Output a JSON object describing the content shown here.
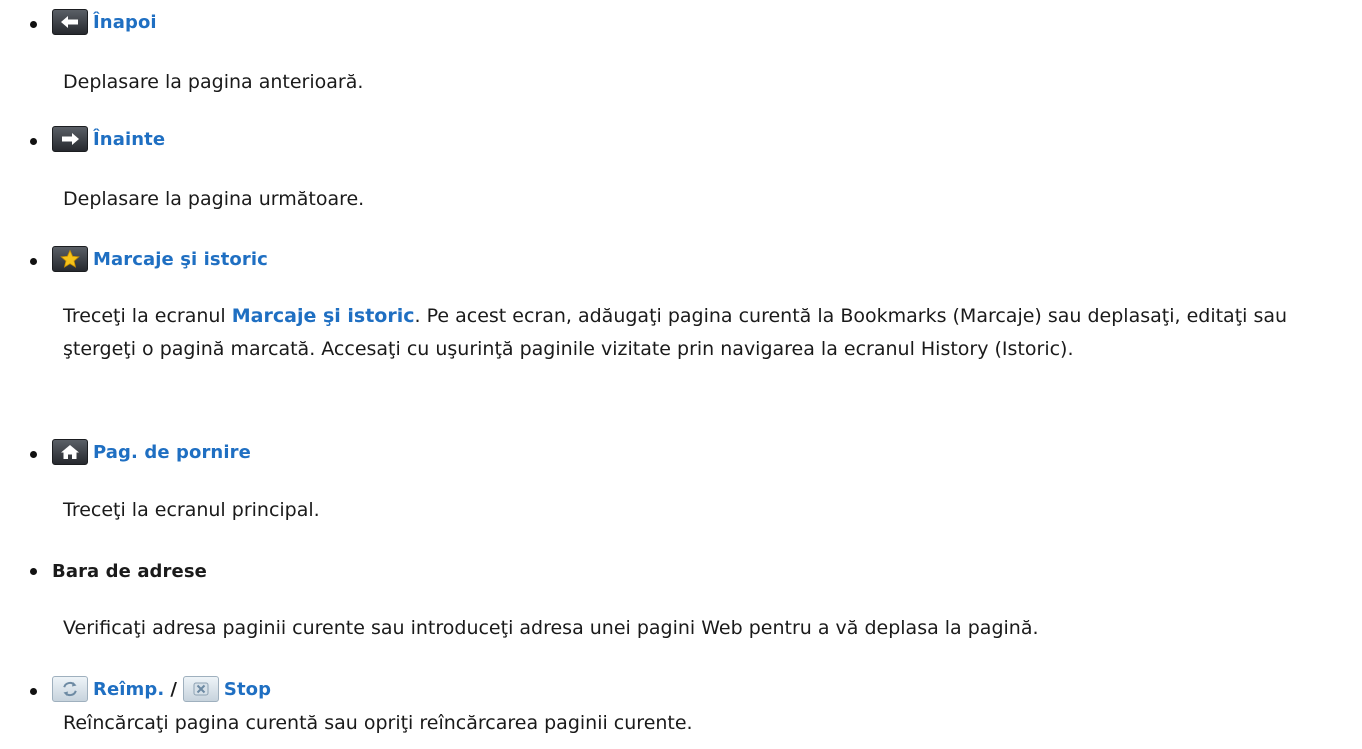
{
  "items": [
    {
      "title": "Înapoi",
      "icon": "arrow-left-icon",
      "description": "Deplasare la pagina anterioară."
    },
    {
      "title": "Înainte",
      "icon": "arrow-right-icon",
      "description": "Deplasare la pagina următoare."
    },
    {
      "title": "Marcaje şi istoric",
      "icon": "star-icon",
      "description_before": "Treceţi la ecranul ",
      "description_keyword": "Marcaje şi istoric",
      "description_after": ". Pe acest ecran, adăugaţi pagina curentă la Bookmarks (Marcaje) sau deplasaţi, editaţi sau ştergeţi o pagină marcată. Accesaţi cu uşurinţă paginile vizitate prin navigarea la ecranul History (Istoric)."
    },
    {
      "title": "Pag. de pornire",
      "icon": "home-icon",
      "description": "Treceţi la ecranul principal."
    },
    {
      "title": "Bara de adrese",
      "description": "Verificaţi adresa paginii curente sau introduceţi adresa unei pagini Web pentru a vă deplasa la pagină."
    },
    {
      "title": "Reîmp.",
      "icon": "refresh-icon",
      "separator": "/",
      "title2": "Stop",
      "icon2": "stop-icon",
      "description": "Reîncărcaţi pagina curentă sau opriţi reîncărcarea paginii curente."
    }
  ],
  "colors": {
    "link": "#1f6fc2",
    "text": "#1a1a1a",
    "star": "#f5c21a"
  }
}
